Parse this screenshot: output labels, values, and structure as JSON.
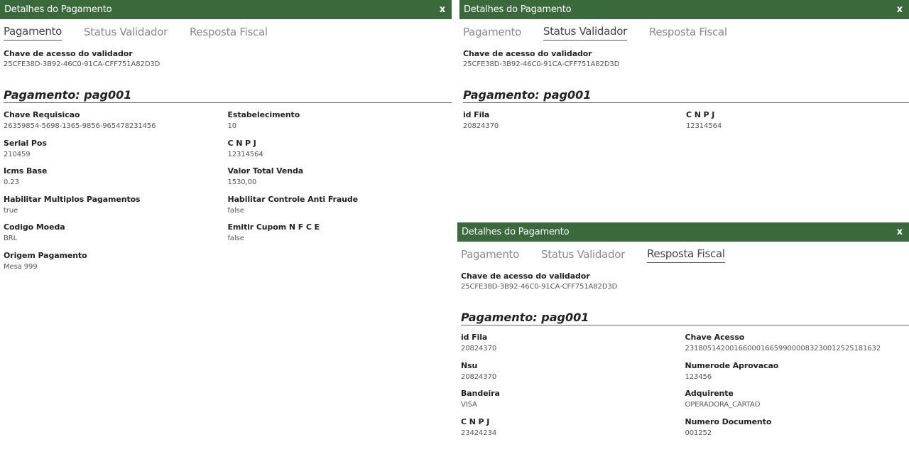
{
  "panels": [
    {
      "title": "Detalhes do Pagamento",
      "close": "x",
      "tabs": [
        "Pagamento",
        "Status Validador",
        "Resposta Fiscal"
      ],
      "active_tab": 0,
      "key_label": "Chave de acesso do validador",
      "key_value": "25CFE38D-3B92-46C0-91CA-CFF751A82D3D",
      "heading": "Pagamento: pag001",
      "fields": [
        {
          "label": "Chave Requisicao",
          "value": "26359854-5698-1365-9856-965478231456"
        },
        {
          "label": "Estabelecimento",
          "value": "10"
        },
        {
          "label": "Serial Pos",
          "value": "210459"
        },
        {
          "label": "C N P J",
          "value": "12314564"
        },
        {
          "label": "Icms Base",
          "value": "0.23"
        },
        {
          "label": "Valor Total Venda",
          "value": "1530,00"
        },
        {
          "label": "Habilitar Multiplos Pagamentos",
          "value": "true"
        },
        {
          "label": "Habilitar Controle Anti Fraude",
          "value": "false"
        },
        {
          "label": "Codigo Moeda",
          "value": "BRL"
        },
        {
          "label": "Emitir Cupom N F C E",
          "value": "false"
        },
        {
          "label": "Origem Pagamento",
          "value": "Mesa 999"
        }
      ]
    },
    {
      "title": "Detalhes do Pagamento",
      "close": "x",
      "tabs": [
        "Pagamento",
        "Status Validador",
        "Resposta Fiscal"
      ],
      "active_tab": 1,
      "key_label": "Chave de acesso do validador",
      "key_value": "25CFE38D-3B92-46C0-91CA-CFF751A82D3D",
      "heading": "Pagamento: pag001",
      "fields": [
        {
          "label": "id Fila",
          "value": "20824370"
        },
        {
          "label": "C N P J",
          "value": "12314564"
        }
      ]
    },
    {
      "title": "Detalhes do Pagamento",
      "close": "x",
      "tabs": [
        "Pagamento",
        "Status Validador",
        "Resposta Fiscal"
      ],
      "active_tab": 2,
      "key_label": "Chave de acesso do validador",
      "key_value": "25CFE38D-3B92-46C0-91CA-CFF751A82D3D",
      "heading": "Pagamento: pag001",
      "fields": [
        {
          "label": "id Fila",
          "value": "20824370"
        },
        {
          "label": "Chave Acesso",
          "value": "23180514200166000166599000083230012525181632"
        },
        {
          "label": "Nsu",
          "value": "20824370"
        },
        {
          "label": "Numerode Aprovacao",
          "value": "123456"
        },
        {
          "label": "Bandeira",
          "value": "VISA"
        },
        {
          "label": "Adquirente",
          "value": "OPERADORA_CARTAO"
        },
        {
          "label": "C N P J",
          "value": "23424234"
        },
        {
          "label": "Numero Documento",
          "value": "001252"
        }
      ]
    }
  ],
  "colors": {
    "titlebar": "#3a6a3c",
    "tab_inactive": "#8a8a8a",
    "tab_active": "#444444"
  }
}
